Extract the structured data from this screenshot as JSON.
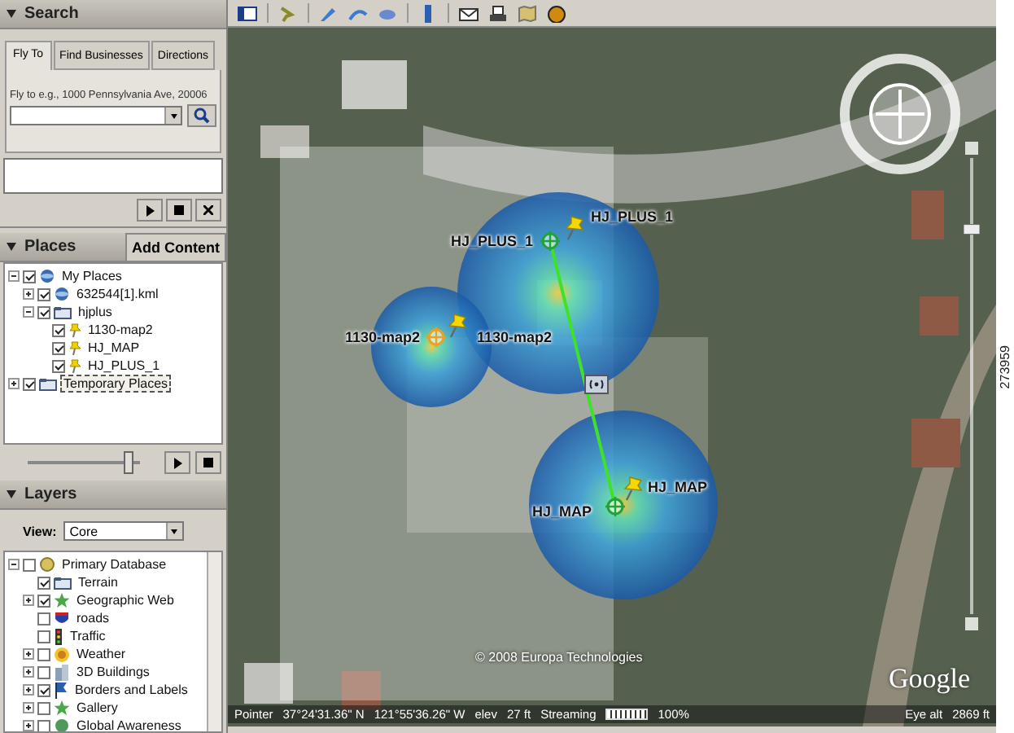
{
  "search": {
    "title": "Search",
    "tabs": [
      {
        "label": "Fly To",
        "selected": true
      },
      {
        "label": "Find Businesses",
        "selected": false
      },
      {
        "label": "Directions",
        "selected": false
      }
    ],
    "hint": "Fly to e.g., 1000 Pennsylvania Ave, 20006"
  },
  "places": {
    "title": "Places",
    "add_content": "Add Content",
    "time_slider": {
      "level": 0.9
    },
    "items": [
      {
        "label": "My Places",
        "kind": "network",
        "checked": true,
        "expanded": true,
        "selected": false,
        "children": [
          {
            "label": "632544[1].kml",
            "kind": "network",
            "checked": true,
            "expanded": false,
            "selected": false
          },
          {
            "label": "hjplus",
            "kind": "folder",
            "checked": true,
            "expanded": true,
            "selected": false,
            "children": [
              {
                "label": "1130-map2",
                "kind": "placemark",
                "checked": true,
                "selected": false
              },
              {
                "label": "HJ_MAP",
                "kind": "placemark",
                "checked": true,
                "selected": false
              },
              {
                "label": "HJ_PLUS_1",
                "kind": "placemark",
                "checked": true,
                "selected": false
              }
            ]
          }
        ]
      },
      {
        "label": "Temporary Places",
        "kind": "folder",
        "checked": true,
        "expanded": false,
        "selected": true
      }
    ]
  },
  "layers": {
    "title": "Layers",
    "view_label": "View:",
    "view_value": "Core",
    "items": [
      {
        "label": "Primary Database",
        "kind": "database",
        "checked": false,
        "expanded": true,
        "children": [
          {
            "label": "Terrain",
            "kind": "folder",
            "checked": true
          },
          {
            "label": "Geographic Web",
            "kind": "star",
            "checked": true,
            "expanded": false
          },
          {
            "label": "roads",
            "kind": "shield",
            "checked": false
          },
          {
            "label": "Traffic",
            "kind": "light",
            "checked": false
          },
          {
            "label": "Weather",
            "kind": "sun",
            "checked": false,
            "expanded": false
          },
          {
            "label": "3D Buildings",
            "kind": "building",
            "checked": false,
            "expanded": false
          },
          {
            "label": "Borders and Labels",
            "kind": "flag",
            "checked": true,
            "expanded": false
          },
          {
            "label": "Gallery",
            "kind": "star",
            "checked": false,
            "expanded": false
          },
          {
            "label": "Global Awareness",
            "kind": "globe",
            "checked": false,
            "expanded": false
          }
        ]
      }
    ]
  },
  "map": {
    "markers": [
      {
        "label_left": "HJ_PLUS_1",
        "label_right": "HJ_PLUS_1",
        "color": "#22a33a"
      },
      {
        "label_left": "1130-map2",
        "label_right": "1130-map2",
        "color": "#f0a020"
      },
      {
        "label_left": "HJ_MAP",
        "label_right": "HJ_MAP",
        "color": "#22a33a"
      }
    ],
    "zoom_slider": {
      "level": 0.85
    },
    "copyright": "© 2008 Europa Technologies",
    "logo": "Google"
  },
  "status_bar": {
    "pointer_label": "Pointer",
    "latitude": "37°24'31.36\" N",
    "longitude": "121°55'36.26\" W",
    "elev_label": "elev",
    "elev_value": "27 ft",
    "streaming_label": "Streaming",
    "streaming_meter": {
      "level": 1
    },
    "streaming_percent": "100%",
    "eye_alt_label": "Eye alt",
    "eye_alt_value": "2869 ft"
  },
  "figure_id": "273959"
}
